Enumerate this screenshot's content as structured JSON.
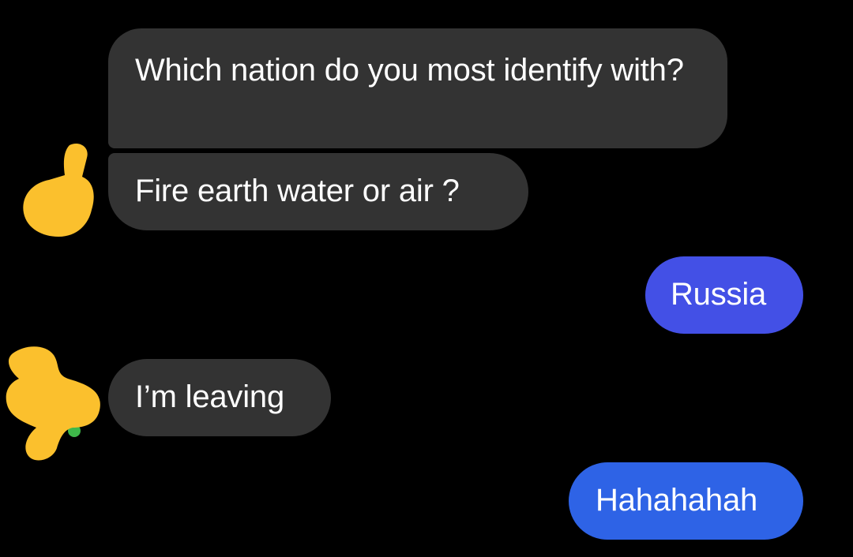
{
  "conversation": {
    "messages": [
      {
        "direction": "incoming",
        "text": "Which nation do you most identify with?"
      },
      {
        "direction": "incoming",
        "text": "Fire earth water or air ?"
      },
      {
        "direction": "outgoing",
        "text": "Russia"
      },
      {
        "direction": "incoming",
        "text": "I’m leaving"
      },
      {
        "direction": "outgoing",
        "text": "Hahahahah"
      }
    ],
    "avatars": [
      {
        "icon": "thumbs-up-scribble-icon"
      },
      {
        "icon": "scribble-avatar-icon"
      }
    ]
  },
  "colors": {
    "background": "#000000",
    "incoming_bubble": "#333333",
    "outgoing_bubble_1": "#4350e6",
    "outgoing_bubble_2": "#2e63e6",
    "scribble": "#fbc02d",
    "text": "#ffffff"
  }
}
